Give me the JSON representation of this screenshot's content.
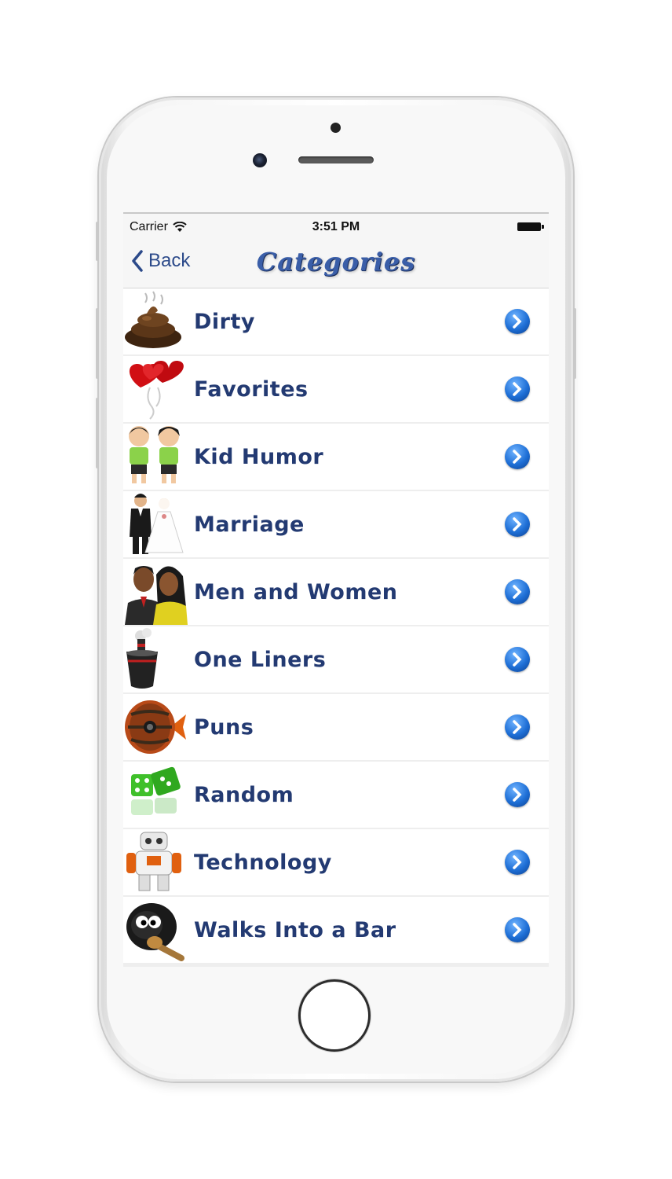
{
  "status_bar": {
    "carrier": "Carrier",
    "time": "3:51 PM"
  },
  "nav": {
    "back_label": "Back",
    "title": "Categories"
  },
  "categories": [
    {
      "label": "Dirty",
      "icon": "poop-icon"
    },
    {
      "label": "Favorites",
      "icon": "heart-balloons-icon"
    },
    {
      "label": "Kid Humor",
      "icon": "kids-icon"
    },
    {
      "label": "Marriage",
      "icon": "bride-groom-icon"
    },
    {
      "label": "Men and Women",
      "icon": "couple-icon"
    },
    {
      "label": "One Liners",
      "icon": "ship-icon"
    },
    {
      "label": "Puns",
      "icon": "barrel-fish-icon"
    },
    {
      "label": "Random",
      "icon": "dice-icon"
    },
    {
      "label": "Technology",
      "icon": "robot-icon"
    },
    {
      "label": "Walks Into a Bar",
      "icon": "sheep-guitar-icon"
    }
  ],
  "colors": {
    "label": "#233a72",
    "title": "#3a5ea8",
    "arrow": "#1e6fd6"
  }
}
